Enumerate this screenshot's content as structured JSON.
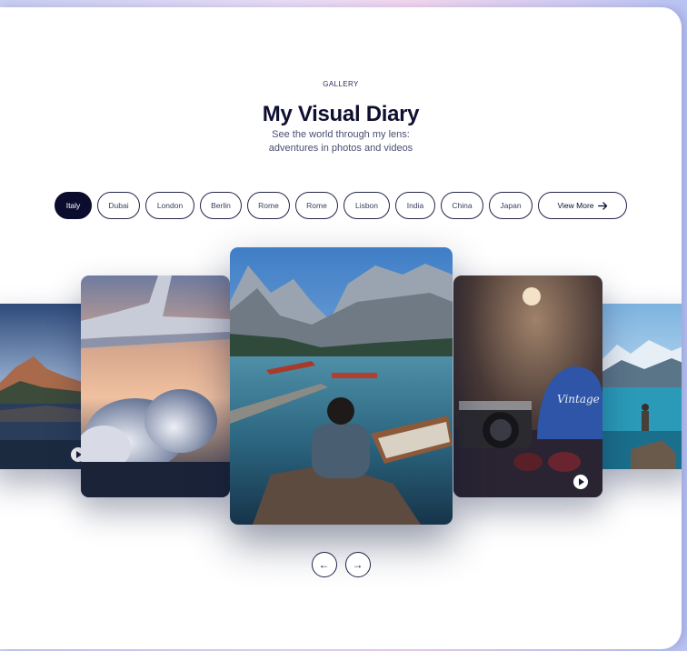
{
  "header": {
    "eyebrow": "GALLERY",
    "title": "My Visual Diary",
    "subtitle_line1": "See the world through my lens:",
    "subtitle_line2": "adventures in photos and videos"
  },
  "filters": {
    "items": [
      "Italy",
      "Dubai",
      "London",
      "Berlin",
      "Rome",
      "Rome",
      "Lisbon",
      "India",
      "China",
      "Japan"
    ],
    "active": "Italy",
    "more_label": "View More",
    "more_icon": "arrow-right-icon"
  },
  "carousel": {
    "slides": [
      {
        "name": "mountain-lake-sunset",
        "type": "video"
      },
      {
        "name": "airplane-wing-clouds",
        "type": "photo"
      },
      {
        "name": "lake-boat-mountains",
        "type": "photo"
      },
      {
        "name": "camera-cap-sunglasses",
        "type": "video",
        "cap_text": "Vintage"
      },
      {
        "name": "turquoise-lake-hiker",
        "type": "photo"
      }
    ]
  },
  "nav": {
    "prev_icon": "arrow-left-icon",
    "next_icon": "arrow-right-icon",
    "prev_glyph": "←",
    "next_glyph": "→"
  },
  "colors": {
    "accent": "#0b0c2e",
    "text": "#0f1030",
    "muted": "#4a4e73",
    "background_gradient": [
      "#c9cff0",
      "#f3d7ee",
      "#b9c4f2"
    ]
  }
}
